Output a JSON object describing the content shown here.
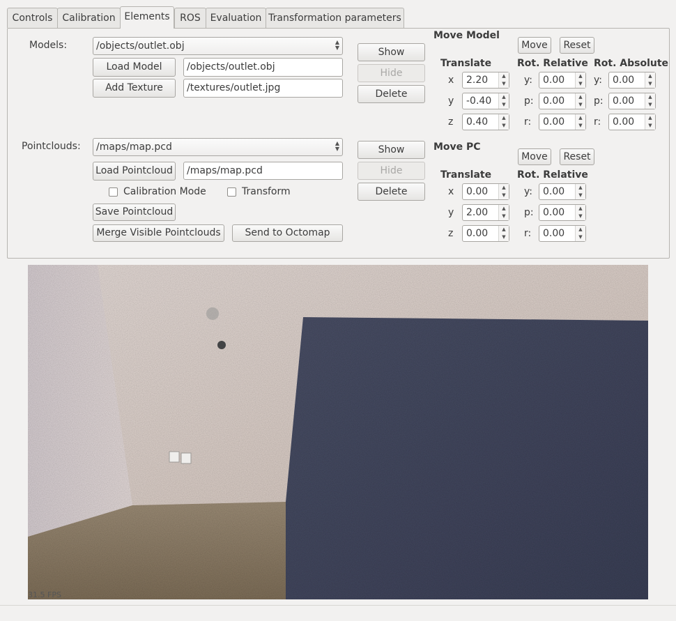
{
  "tabs": [
    {
      "label": "Controls",
      "active": false
    },
    {
      "label": "Calibration",
      "active": false
    },
    {
      "label": "Elements",
      "active": true
    },
    {
      "label": "ROS",
      "active": false
    },
    {
      "label": "Evaluation",
      "active": false
    },
    {
      "label": "Transformation parameters",
      "active": false
    }
  ],
  "models": {
    "label": "Models:",
    "selected": "/objects/outlet.obj",
    "load_button": "Load Model",
    "load_path": "/objects/outlet.obj",
    "texture_button": "Add Texture",
    "texture_path": "/textures/outlet.jpg",
    "show_button": "Show",
    "hide_button": "Hide",
    "delete_button": "Delete"
  },
  "move_model": {
    "title": "Move Model",
    "move_button": "Move",
    "reset_button": "Reset",
    "translate_header": "Translate",
    "rot_relative_header": "Rot. Relative",
    "rot_absolute_header": "Rot. Absolute",
    "x_label": "x",
    "y_label": "y",
    "z_label": "z",
    "tx": "2.20",
    "ty": "-0.40",
    "tz": "0.40",
    "rel_y_label": "y:",
    "rel_p_label": "p:",
    "rel_r_label": "r:",
    "rel_y": "0.00",
    "rel_p": "0.00",
    "rel_r": "0.00",
    "abs_y_label": "y:",
    "abs_p_label": "p:",
    "abs_r_label": "r:",
    "abs_y": "0.00",
    "abs_p": "0.00",
    "abs_r": "0.00"
  },
  "pointclouds": {
    "label": "Pointclouds:",
    "selected": "/maps/map.pcd",
    "load_button": "Load Pointcloud",
    "load_path": "/maps/map.pcd",
    "calibration_mode": "Calibration Mode",
    "transform": "Transform",
    "save_button": "Save Pointcloud",
    "merge_button": "Merge Visible Pointclouds",
    "octomap_button": "Send to Octomap",
    "show_button": "Show",
    "hide_button": "Hide",
    "delete_button": "Delete"
  },
  "move_pc": {
    "title": "Move PC",
    "move_button": "Move",
    "reset_button": "Reset",
    "translate_header": "Translate",
    "rot_relative_header": "Rot. Relative",
    "x_label": "x",
    "y_label": "y",
    "z_label": "z",
    "tx": "0.00",
    "ty": "2.00",
    "tz": "0.00",
    "rel_y_label": "y:",
    "rel_p_label": "p:",
    "rel_r_label": "r:",
    "rel_y": "0.00",
    "rel_p": "0.00",
    "rel_r": "0.00"
  },
  "viewport": {
    "fps": "31.5 FPS"
  }
}
